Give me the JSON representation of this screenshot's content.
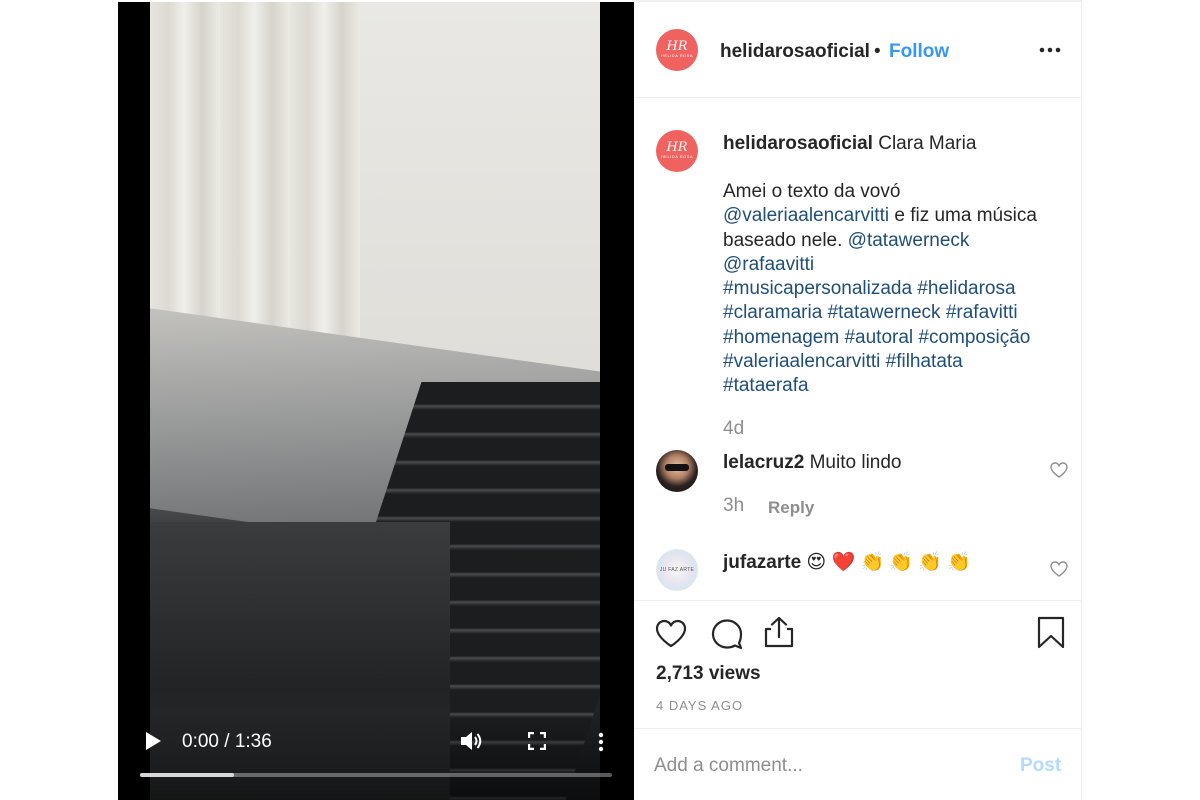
{
  "video": {
    "time_display": "0:00 / 1:36",
    "progress_buffered": 0.2,
    "icons": {
      "play": "play-icon",
      "volume": "volume-icon",
      "fullscreen": "fullscreen-icon",
      "more": "more-vertical-icon"
    }
  },
  "header": {
    "username": "helidarosaoficial",
    "separator": "•",
    "follow_label": "Follow",
    "avatar_monogram": "HR",
    "avatar_subtext": "HELIDA ROSA"
  },
  "caption": {
    "username": "helidarosaoficial",
    "title": "Clara Maria",
    "line1": "Amei o texto da vovó",
    "mention1": "@valeriaalencarvitti",
    "line2_rest": " e fiz uma música",
    "line3_start": "baseado nele. ",
    "mention2": "@tatawerneck",
    "mention3": "@rafaavitti",
    "hashtags_line1": "#musicapersonalizada #helidarosa",
    "hashtags_line2": "#claramaria #tatawerneck #rafavitti",
    "hashtags_line3": "#homenagem #autoral #composição",
    "hashtags_line4": "#valeriaalencarvitti #filhatata",
    "hashtags_line5": "#tataerafa",
    "age": "4d"
  },
  "comments": [
    {
      "username": "lelacruz2",
      "text": "Muito lindo",
      "time": "3h",
      "reply_label": "Reply"
    },
    {
      "username": "jufazarte",
      "text": "😍 ❤️ 👏 👏 👏 👏",
      "avatar_text": "JU FAZ ARTE"
    }
  ],
  "stats": {
    "views": "2,713 views",
    "date": "4 DAYS AGO"
  },
  "add_comment": {
    "placeholder": "Add a comment...",
    "post_label": "Post"
  },
  "colors": {
    "link_blue": "#3897f0",
    "mention_blue": "#1f4e79",
    "brand_avatar": "#f0625f",
    "secondary_text": "#8e8e8e",
    "post_disabled": "#b3dbff"
  }
}
